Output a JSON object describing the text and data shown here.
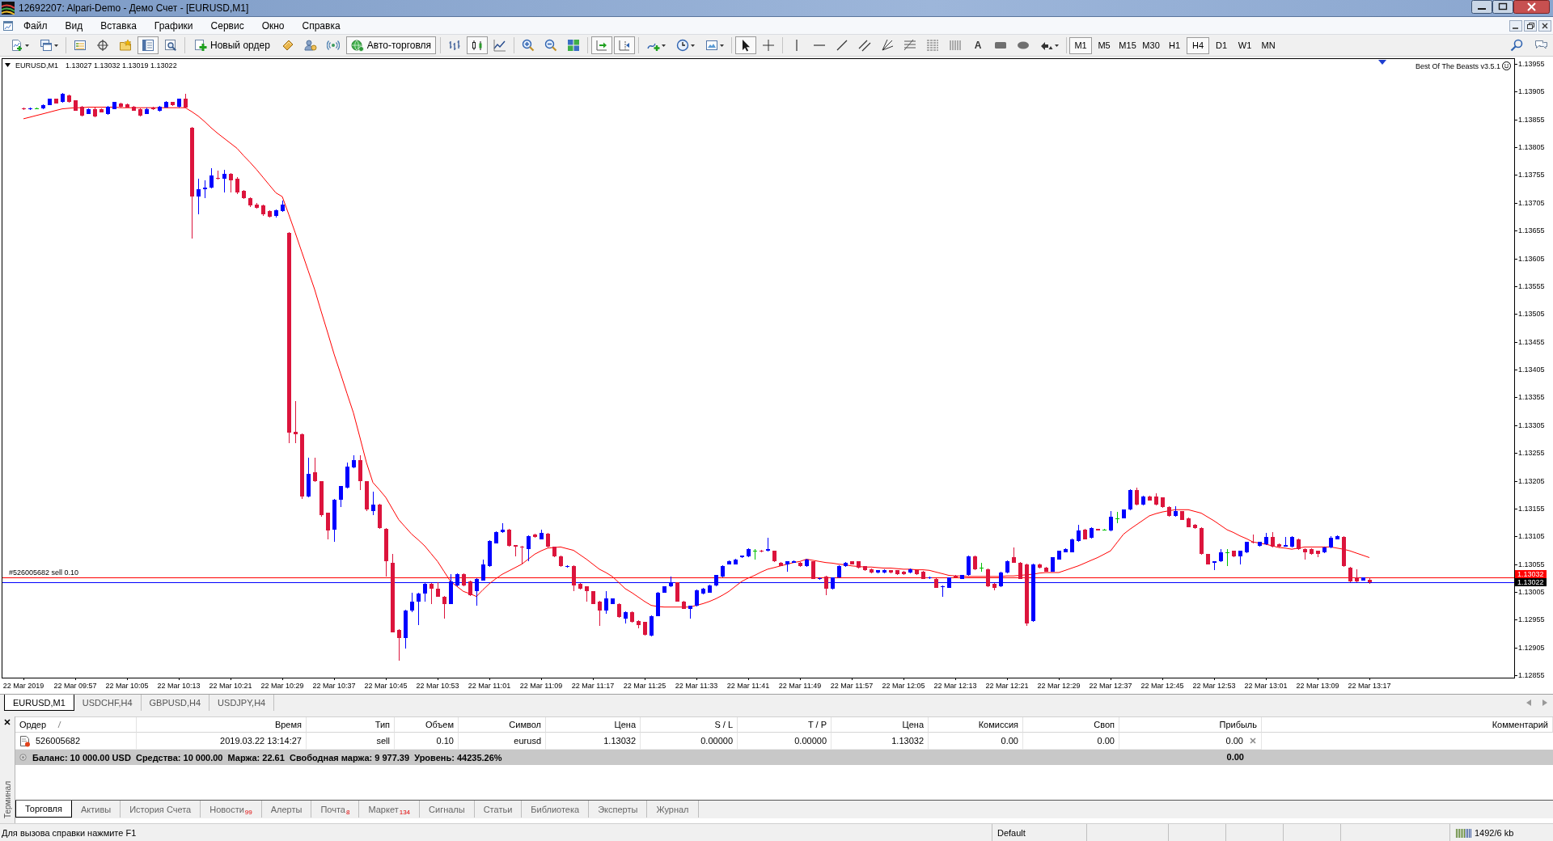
{
  "window": {
    "title": "12692207: Alpari-Demo - Демо Счет - [EURUSD,M1]"
  },
  "menu": [
    "Файл",
    "Вид",
    "Вставка",
    "Графики",
    "Сервис",
    "Окно",
    "Справка"
  ],
  "toolbar": {
    "windows": [
      {
        "selected": false
      },
      {
        "selected": false
      },
      {
        "selected": false
      },
      {
        "selected": true
      },
      {
        "selected": false
      }
    ],
    "new_order": "Новый ордер",
    "auto_trading": {
      "label": "Авто-торговля",
      "on": true
    },
    "chart_types": [
      {
        "selected": false
      },
      {
        "selected": true
      },
      {
        "selected": false
      }
    ],
    "chart_options": [
      {
        "selected": true
      },
      {
        "selected": true
      }
    ],
    "pointer_tools": [
      {
        "selected": true
      },
      {
        "selected": false
      }
    ],
    "text_tool": "A",
    "timeframes": [
      {
        "label": "M1",
        "selected": true
      },
      {
        "label": "M5",
        "selected": false
      },
      {
        "label": "M15",
        "selected": false
      },
      {
        "label": "M30",
        "selected": false
      },
      {
        "label": "H1",
        "selected": false
      },
      {
        "label": "H4",
        "selected": true
      },
      {
        "label": "D1",
        "selected": false
      },
      {
        "label": "W1",
        "selected": false
      },
      {
        "label": "MN",
        "selected": false
      }
    ]
  },
  "chart": {
    "symbol": "EURUSD,M1",
    "prices": "1.13027 1.13032 1.13019 1.13022",
    "indicator": "Best Of The Beasts v3.5.1",
    "price_tags": [
      {
        "label": "1.13032",
        "color": "#ff0000"
      },
      {
        "label": "1.13022",
        "color": "#000000"
      }
    ],
    "chart_data": {
      "type": "candlestick",
      "categories": [
        "22 Mar 2019",
        null,
        null,
        null,
        null,
        null,
        null,
        null,
        "22 Mar 09:57",
        null,
        null,
        null,
        null,
        null,
        null,
        null,
        "22 Mar 10:05",
        null,
        null,
        null,
        null,
        null,
        null,
        null,
        "22 Mar 10:13",
        null,
        null,
        null,
        null,
        null,
        null,
        null,
        "22 Mar 10:21",
        null,
        null,
        null,
        null,
        null,
        null,
        null,
        "22 Mar 10:29",
        null,
        null,
        null,
        null,
        null,
        null,
        null,
        "22 Mar 10:37",
        null,
        null,
        null,
        null,
        null,
        null,
        null,
        "22 Mar 10:45",
        null,
        null,
        null,
        null,
        null,
        null,
        null,
        "22 Mar 10:53",
        null,
        null,
        null,
        null,
        null,
        null,
        null,
        "22 Mar 11:01",
        null,
        null,
        null,
        null,
        null,
        null,
        null,
        "22 Mar 11:09",
        null,
        null,
        null,
        null,
        null,
        null,
        null,
        "22 Mar 11:17",
        null,
        null,
        null,
        null,
        null,
        null,
        null,
        "22 Mar 11:25",
        null,
        null,
        null,
        null,
        null,
        null,
        null,
        "22 Mar 11:33",
        null,
        null,
        null,
        null,
        null,
        null,
        null,
        "22 Mar 11:41",
        null,
        null,
        null,
        null,
        null,
        null,
        null,
        "22 Mar 11:49",
        null,
        null,
        null,
        null,
        null,
        null,
        null,
        "22 Mar 11:57",
        null,
        null,
        null,
        null,
        null,
        null,
        null,
        "22 Mar 12:05",
        null,
        null,
        null,
        null,
        null,
        null,
        null,
        "22 Mar 12:13",
        null,
        null,
        null,
        null,
        null,
        null,
        null,
        "22 Mar 12:21",
        null,
        null,
        null,
        null,
        null,
        null,
        null,
        "22 Mar 12:29",
        null,
        null,
        null,
        null,
        null,
        null,
        null,
        "22 Mar 12:37",
        null,
        null,
        null,
        null,
        null,
        null,
        null,
        "22 Mar 12:45",
        null,
        null,
        null,
        null,
        null,
        null,
        null,
        "22 Mar 12:53",
        null,
        null,
        null,
        null,
        null,
        null,
        null,
        "22 Mar 13:01",
        null,
        null,
        null,
        null,
        null,
        null,
        null,
        "22 Mar 13:09",
        null,
        null,
        null,
        null,
        null,
        null,
        null,
        "22 Mar 13:17"
      ],
      "ohlc": [
        [
          1.13875,
          1.13876,
          1.13872,
          1.13873
        ],
        [
          1.13873,
          1.13876,
          1.13872,
          1.13875
        ],
        [
          1.13875,
          1.13877,
          1.13873,
          1.13875
        ],
        [
          1.13875,
          1.13882,
          1.13874,
          1.13881
        ],
        [
          1.13881,
          1.13893,
          1.1388,
          1.13892
        ],
        [
          1.13892,
          1.13893,
          1.13883,
          1.13884
        ],
        [
          1.13886,
          1.13903,
          1.13885,
          1.13901
        ],
        [
          1.13898,
          1.13899,
          1.13885,
          1.13886
        ],
        [
          1.13889,
          1.1389,
          1.1387,
          1.13871
        ],
        [
          1.13878,
          1.13879,
          1.13861,
          1.13862
        ],
        [
          1.13865,
          1.13875,
          1.13864,
          1.13874
        ],
        [
          1.13874,
          1.13876,
          1.13859,
          1.13861
        ],
        [
          1.13874,
          1.13875,
          1.13867,
          1.13868
        ],
        [
          1.13865,
          1.13879,
          1.13863,
          1.13878
        ],
        [
          1.13874,
          1.13887,
          1.13873,
          1.13886
        ],
        [
          1.13883,
          1.13885,
          1.13877,
          1.13878
        ],
        [
          1.13882,
          1.13883,
          1.13876,
          1.13877
        ],
        [
          1.13878,
          1.13879,
          1.1387,
          1.13871
        ],
        [
          1.13874,
          1.13875,
          1.13861,
          1.13862
        ],
        [
          1.13865,
          1.13876,
          1.13864,
          1.13874
        ],
        [
          1.13877,
          1.13878,
          1.13872,
          1.13873
        ],
        [
          1.1387,
          1.13879,
          1.13869,
          1.13878
        ],
        [
          1.13877,
          1.13888,
          1.13876,
          1.13887
        ],
        [
          1.13886,
          1.13887,
          1.13879,
          1.1388
        ],
        [
          1.13878,
          1.13893,
          1.13877,
          1.13892
        ],
        [
          1.13892,
          1.13901,
          1.13875,
          1.13876
        ],
        [
          1.1384,
          1.13841,
          1.13641,
          1.13716
        ],
        [
          1.13716,
          1.13749,
          1.13684,
          1.13729
        ],
        [
          1.1373,
          1.13745,
          1.13714,
          1.13732
        ],
        [
          1.13732,
          1.13767,
          1.13731,
          1.13754
        ],
        [
          1.1375,
          1.13763,
          1.13747,
          1.13748
        ],
        [
          1.13748,
          1.13765,
          1.13723,
          1.13757
        ],
        [
          1.13757,
          1.13758,
          1.13723,
          1.13745
        ],
        [
          1.13749,
          1.13751,
          1.13721,
          1.13723
        ],
        [
          1.13727,
          1.13728,
          1.13712,
          1.13714
        ],
        [
          1.13714,
          1.13715,
          1.13698,
          1.137
        ],
        [
          1.13702,
          1.13704,
          1.13695,
          1.13696
        ],
        [
          1.137,
          1.13702,
          1.13682,
          1.13684
        ],
        [
          1.1369,
          1.13692,
          1.13678,
          1.1368
        ],
        [
          1.13681,
          1.13693,
          1.13679,
          1.13692
        ],
        [
          1.1369,
          1.13709,
          1.13689,
          1.13702
        ],
        [
          1.13651,
          1.13652,
          1.13273,
          1.13291
        ],
        [
          1.13293,
          1.13349,
          1.13273,
          1.13289
        ],
        [
          1.13289,
          1.1329,
          1.13173,
          1.13177
        ],
        [
          1.13177,
          1.13247,
          1.13175,
          1.13218
        ],
        [
          1.1322,
          1.13247,
          1.13203,
          1.13204
        ],
        [
          1.13204,
          1.13205,
          1.1314,
          1.13144
        ],
        [
          1.13147,
          1.13148,
          1.131,
          1.13116
        ],
        [
          1.13117,
          1.13172,
          1.13095,
          1.13171
        ],
        [
          1.13171,
          1.13196,
          1.13158,
          1.13195
        ],
        [
          1.13193,
          1.13238,
          1.13192,
          1.13231
        ],
        [
          1.13229,
          1.13251,
          1.13228,
          1.13242
        ],
        [
          1.13242,
          1.13251,
          1.13189,
          1.13204
        ],
        [
          1.13204,
          1.13205,
          1.13151,
          1.13153
        ],
        [
          1.1315,
          1.13186,
          1.13144,
          1.13162
        ],
        [
          1.13162,
          1.13163,
          1.13118,
          1.1312
        ],
        [
          1.13119,
          1.1312,
          1.13033,
          1.1306
        ],
        [
          1.13058,
          1.13073,
          1.12932,
          1.12933
        ],
        [
          1.12937,
          1.12938,
          1.12882,
          1.12922
        ],
        [
          1.12922,
          1.12973,
          1.12904,
          1.12972
        ],
        [
          1.12972,
          1.13004,
          1.12969,
          1.12987
        ],
        [
          1.12987,
          1.13003,
          1.12946,
          1.13002
        ],
        [
          1.13002,
          1.13022,
          1.12988,
          1.1302
        ],
        [
          1.1302,
          1.13021,
          1.12984,
          1.13011
        ],
        [
          1.13011,
          1.13022,
          1.12996,
          1.12997
        ],
        [
          1.12997,
          1.12998,
          1.12957,
          1.12984
        ],
        [
          1.12984,
          1.13037,
          1.12983,
          1.13024
        ],
        [
          1.13017,
          1.13038,
          1.13016,
          1.13037
        ],
        [
          1.13037,
          1.13038,
          1.13016,
          1.13017
        ],
        [
          1.13024,
          1.13025,
          1.12998,
          1.12999
        ],
        [
          1.13006,
          1.1303,
          1.1298,
          1.13029
        ],
        [
          1.13026,
          1.13064,
          1.13025,
          1.13055
        ],
        [
          1.13051,
          1.13098,
          1.1305,
          1.13097
        ],
        [
          1.13093,
          1.13114,
          1.13092,
          1.13113
        ],
        [
          1.13113,
          1.13129,
          1.13112,
          1.13117
        ],
        [
          1.13117,
          1.13118,
          1.13087,
          1.13088
        ],
        [
          1.13089,
          1.1309,
          1.13069,
          1.13087
        ],
        [
          1.13087,
          1.13088,
          1.13055,
          1.13085
        ],
        [
          1.13082,
          1.13107,
          1.1306,
          1.13106
        ],
        [
          1.13109,
          1.1311,
          1.13103,
          1.13104
        ],
        [
          1.131,
          1.13117,
          1.13099,
          1.13111
        ],
        [
          1.1311,
          1.13111,
          1.13085,
          1.13086
        ],
        [
          1.13086,
          1.13087,
          1.13068,
          1.13069
        ],
        [
          1.13069,
          1.1307,
          1.1305,
          1.13051
        ],
        [
          1.1305,
          1.13053,
          1.13049,
          1.13052
        ],
        [
          1.13052,
          1.13053,
          1.13006,
          1.13017
        ],
        [
          1.1302,
          1.13021,
          1.1301,
          1.13011
        ],
        [
          1.13015,
          1.13016,
          1.12988,
          1.13006
        ],
        [
          1.13006,
          1.13007,
          1.12983,
          1.12984
        ],
        [
          1.12988,
          1.12989,
          1.12944,
          1.12971
        ],
        [
          1.12971,
          1.13006,
          1.12966,
          1.12993
        ],
        [
          1.12984,
          1.12994,
          1.12983,
          1.12993
        ],
        [
          1.12984,
          1.12985,
          1.12959,
          1.1296
        ],
        [
          1.12957,
          1.1297,
          1.12948,
          1.12969
        ],
        [
          1.12969,
          1.1297,
          1.1295,
          1.12951
        ],
        [
          1.12953,
          1.12954,
          1.12939,
          1.12946
        ],
        [
          1.12951,
          1.12952,
          1.12927,
          1.12928
        ],
        [
          1.12926,
          1.12963,
          1.12925,
          1.12962
        ],
        [
          1.12962,
          1.13005,
          1.12961,
          1.13004
        ],
        [
          1.13004,
          1.13016,
          1.13003,
          1.13015
        ],
        [
          1.13015,
          1.13033,
          1.13014,
          1.13022
        ],
        [
          1.13022,
          1.13023,
          1.12987,
          1.12988
        ],
        [
          1.12988,
          1.12989,
          1.12974,
          1.12975
        ],
        [
          1.12975,
          1.12981,
          1.12957,
          1.1298
        ],
        [
          1.1298,
          1.13009,
          1.12979,
          1.13008
        ],
        [
          1.13002,
          1.13012,
          1.13001,
          1.13011
        ],
        [
          1.13004,
          1.13018,
          1.13003,
          1.13017
        ],
        [
          1.13017,
          1.13036,
          1.13016,
          1.13035
        ],
        [
          1.13033,
          1.13053,
          1.13032,
          1.13052
        ],
        [
          1.13055,
          1.13062,
          1.13054,
          1.13061
        ],
        [
          1.13055,
          1.13065,
          1.13054,
          1.13064
        ],
        [
          1.13067,
          1.13071,
          1.13066,
          1.1307
        ],
        [
          1.13069,
          1.13083,
          1.13068,
          1.13082
        ],
        [
          1.13079,
          1.13082,
          1.13064,
          1.13079
        ],
        [
          1.1308,
          1.13081,
          1.13077,
          1.13078
        ],
        [
          1.13079,
          1.13102,
          1.13078,
          1.13082
        ],
        [
          1.13079,
          1.1308,
          1.13059,
          1.1306
        ],
        [
          1.13058,
          1.13059,
          1.13051,
          1.13052
        ],
        [
          1.13055,
          1.13061,
          1.13042,
          1.1306
        ],
        [
          1.13058,
          1.13062,
          1.13057,
          1.13061
        ],
        [
          1.13058,
          1.13059,
          1.1305,
          1.13051
        ],
        [
          1.13051,
          1.13065,
          1.1305,
          1.13064
        ],
        [
          1.1306,
          1.13061,
          1.13028,
          1.13029
        ],
        [
          1.13028,
          1.13031,
          1.13027,
          1.1303
        ],
        [
          1.13033,
          1.13034,
          1.12999,
          1.13011
        ],
        [
          1.13011,
          1.13032,
          1.1301,
          1.13031
        ],
        [
          1.13031,
          1.13053,
          1.1303,
          1.13052
        ],
        [
          1.13051,
          1.13059,
          1.1305,
          1.13058
        ],
        [
          1.1306,
          1.13061,
          1.13054,
          1.13055
        ],
        [
          1.1306,
          1.13061,
          1.13048,
          1.13049
        ],
        [
          1.13051,
          1.13052,
          1.13043,
          1.13044
        ],
        [
          1.13046,
          1.13047,
          1.13039,
          1.1304
        ],
        [
          1.1304,
          1.13045,
          1.13039,
          1.13044
        ],
        [
          1.1304,
          1.13046,
          1.13039,
          1.13045
        ],
        [
          1.13044,
          1.13045,
          1.13039,
          1.1304
        ],
        [
          1.13044,
          1.13045,
          1.13036,
          1.13037
        ],
        [
          1.13042,
          1.13043,
          1.13036,
          1.13037
        ],
        [
          1.1304,
          1.13047,
          1.13039,
          1.13046
        ],
        [
          1.13044,
          1.13045,
          1.13036,
          1.13037
        ],
        [
          1.13042,
          1.13043,
          1.13028,
          1.13029
        ],
        [
          1.1303,
          1.13033,
          1.13029,
          1.13032
        ],
        [
          1.13029,
          1.1303,
          1.13012,
          1.13013
        ],
        [
          1.13014,
          1.13017,
          1.12997,
          1.13016
        ],
        [
          1.13013,
          1.13032,
          1.13012,
          1.13031
        ],
        [
          1.13034,
          1.13035,
          1.13031,
          1.13032
        ],
        [
          1.13029,
          1.13036,
          1.13028,
          1.13035
        ],
        [
          1.13035,
          1.1307,
          1.13034,
          1.13069
        ],
        [
          1.13069,
          1.1307,
          1.13045,
          1.13046
        ],
        [
          1.13049,
          1.13058,
          1.13042,
          1.13049
        ],
        [
          1.13046,
          1.13047,
          1.13014,
          1.13015
        ],
        [
          1.1302,
          1.13021,
          1.13008,
          1.13013
        ],
        [
          1.13015,
          1.13041,
          1.13014,
          1.1304
        ],
        [
          1.1304,
          1.13062,
          1.13039,
          1.13061
        ],
        [
          1.13067,
          1.13085,
          1.13057,
          1.13058
        ],
        [
          1.13058,
          1.13059,
          1.13028,
          1.13029
        ],
        [
          1.13055,
          1.13056,
          1.12944,
          1.12948
        ],
        [
          1.12953,
          1.13056,
          1.12952,
          1.13055
        ],
        [
          1.13055,
          1.13056,
          1.13048,
          1.13049
        ],
        [
          1.13049,
          1.1305,
          1.13041,
          1.13042
        ],
        [
          1.13042,
          1.13068,
          1.13041,
          1.13067
        ],
        [
          1.13064,
          1.1308,
          1.13063,
          1.13079
        ],
        [
          1.13077,
          1.13083,
          1.13076,
          1.13082
        ],
        [
          1.13077,
          1.13101,
          1.13076,
          1.131
        ],
        [
          1.13097,
          1.13126,
          1.13096,
          1.13115
        ],
        [
          1.13117,
          1.13118,
          1.13099,
          1.131
        ],
        [
          1.13102,
          1.13121,
          1.13101,
          1.1312
        ],
        [
          1.13118,
          1.13119,
          1.13115,
          1.13116
        ],
        [
          1.13117,
          1.13119,
          1.13115,
          1.13117
        ],
        [
          1.13115,
          1.1315,
          1.13114,
          1.1314
        ],
        [
          1.13138,
          1.13149,
          1.13129,
          1.13138
        ],
        [
          1.13138,
          1.13154,
          1.13137,
          1.13153
        ],
        [
          1.13153,
          1.1319,
          1.13152,
          1.13189
        ],
        [
          1.13189,
          1.13193,
          1.13161,
          1.13162
        ],
        [
          1.13162,
          1.13178,
          1.13161,
          1.13177
        ],
        [
          1.13177,
          1.13178,
          1.13169,
          1.1317
        ],
        [
          1.13177,
          1.13182,
          1.13161,
          1.13162
        ],
        [
          1.13175,
          1.13176,
          1.13157,
          1.13158
        ],
        [
          1.13158,
          1.13159,
          1.13141,
          1.13142
        ],
        [
          1.13142,
          1.13159,
          1.13141,
          1.1315
        ],
        [
          1.1315,
          1.13151,
          1.13134,
          1.13135
        ],
        [
          1.13138,
          1.13139,
          1.13121,
          1.13122
        ],
        [
          1.13126,
          1.13127,
          1.13119,
          1.1312
        ],
        [
          1.1312,
          1.13121,
          1.13072,
          1.13073
        ],
        [
          1.13073,
          1.13074,
          1.13054,
          1.13055
        ],
        [
          1.13058,
          1.13061,
          1.13044,
          1.1306
        ],
        [
          1.1306,
          1.13082,
          1.13059,
          1.13076
        ],
        [
          1.13077,
          1.13082,
          1.13052,
          1.13077
        ],
        [
          1.13079,
          1.1308,
          1.13068,
          1.13069
        ],
        [
          1.13069,
          1.1308,
          1.13055,
          1.13079
        ],
        [
          1.13076,
          1.13096,
          1.13075,
          1.13095
        ],
        [
          1.13096,
          1.13109,
          1.13093,
          1.13094
        ],
        [
          1.13088,
          1.13096,
          1.13087,
          1.13095
        ],
        [
          1.13091,
          1.13111,
          1.1309,
          1.13104
        ],
        [
          1.13104,
          1.13113,
          1.13085,
          1.13086
        ],
        [
          1.13091,
          1.13092,
          1.13085,
          1.13086
        ],
        [
          1.13087,
          1.13104,
          1.13086,
          1.13089
        ],
        [
          1.13086,
          1.13105,
          1.13085,
          1.13104
        ],
        [
          1.131,
          1.13101,
          1.13081,
          1.13082
        ],
        [
          1.13082,
          1.13083,
          1.13064,
          1.13077
        ],
        [
          1.13082,
          1.13083,
          1.13072,
          1.13073
        ],
        [
          1.13079,
          1.1308,
          1.13067,
          1.13073
        ],
        [
          1.13076,
          1.13086,
          1.13075,
          1.13085
        ],
        [
          1.13085,
          1.13106,
          1.13084,
          1.13102
        ],
        [
          1.131,
          1.13107,
          1.13099,
          1.13106
        ],
        [
          1.13104,
          1.13105,
          1.1305,
          1.13051
        ],
        [
          1.13049,
          1.1305,
          1.13023,
          1.13024
        ],
        [
          1.13031,
          1.13046,
          1.13023,
          1.13024
        ],
        [
          1.13026,
          1.13032,
          1.13025,
          1.13031
        ],
        [
          1.13027,
          1.13032,
          1.13019,
          1.13022
        ]
      ],
      "series": [
        {
          "type": "line",
          "color": "#ff0000",
          "values": [
            1.13856,
            1.13859,
            1.13862,
            1.13865,
            1.13868,
            1.13871,
            1.13874,
            1.13875,
            1.13876,
            1.13876,
            1.13877,
            1.13877,
            1.13877,
            1.13877,
            1.13877,
            1.13876,
            1.13876,
            1.13876,
            1.13876,
            1.13876,
            1.13876,
            1.13876,
            1.13876,
            1.13876,
            1.13876,
            1.13876,
            1.13869,
            1.13861,
            1.13851,
            1.1384,
            1.1383,
            1.13821,
            1.13812,
            1.13803,
            1.1379,
            1.13778,
            1.13765,
            1.13751,
            1.13737,
            1.13723,
            1.13716,
            1.13684,
            1.13651,
            1.13617,
            1.13583,
            1.13549,
            1.1351,
            1.13472,
            1.13433,
            1.13398,
            1.13362,
            1.13327,
            1.13283,
            1.13238,
            1.13202,
            1.13189,
            1.13175,
            1.13155,
            1.13135,
            1.13122,
            1.13109,
            1.13099,
            1.13088,
            1.13074,
            1.1306,
            1.13042,
            1.13024,
            1.13015,
            1.13006,
            1.13002,
            1.12997,
            1.13009,
            1.1302,
            1.13029,
            1.13037,
            1.13043,
            1.13049,
            1.13055,
            1.13064,
            1.13073,
            1.13079,
            1.13084,
            1.13085,
            1.13086,
            1.13083,
            1.1308,
            1.13072,
            1.13064,
            1.13055,
            1.13046,
            1.1304,
            1.13033,
            1.13022,
            1.13011,
            1.13004,
            1.12996,
            1.12988,
            1.12981,
            1.12979,
            1.12978,
            1.12978,
            1.12978,
            1.12978,
            1.12978,
            1.12981,
            1.12984,
            1.12988,
            1.12993,
            1.12999,
            1.13006,
            1.13015,
            1.13024,
            1.1303,
            1.13035,
            1.13041,
            1.13046,
            1.13049,
            1.13052,
            1.13055,
            1.13058,
            1.1306,
            1.13064,
            1.13062,
            1.1306,
            1.13058,
            1.13057,
            1.13055,
            1.13054,
            1.13052,
            1.13051,
            1.1305,
            1.1305,
            1.13049,
            1.13048,
            1.13048,
            1.13047,
            1.13046,
            1.13046,
            1.13045,
            1.13045,
            1.13044,
            1.13041,
            1.13038,
            1.13035,
            1.13034,
            1.13034,
            1.13033,
            1.13033,
            1.13033,
            1.13033,
            1.13033,
            1.13033,
            1.13034,
            1.13034,
            1.13035,
            1.13036,
            1.13037,
            1.13039,
            1.1304,
            1.1304,
            1.1304,
            1.13044,
            1.13048,
            1.13052,
            1.13057,
            1.13062,
            1.13067,
            1.13073,
            1.13079,
            1.13094,
            1.13109,
            1.13118,
            1.13126,
            1.13134,
            1.13142,
            1.13146,
            1.13149,
            1.13151,
            1.13153,
            1.13153,
            1.13153,
            1.1315,
            1.13147,
            1.1314,
            1.13133,
            1.13125,
            1.13117,
            1.13112,
            1.13106,
            1.13101,
            1.13095,
            1.13093,
            1.13091,
            1.13088,
            1.13085,
            1.13084,
            1.13082,
            1.13084,
            1.13086,
            1.13086,
            1.13086,
            1.13086,
            1.13086,
            1.13084,
            1.13082,
            1.13079,
            1.13075,
            1.13071,
            1.13067
          ]
        }
      ],
      "ylim": [
        1.12851,
        1.13965
      ],
      "yticks": [
        1.12855,
        1.12905,
        1.12955,
        1.13005,
        1.13055,
        1.13105,
        1.13155,
        1.13205,
        1.13255,
        1.13305,
        1.13355,
        1.13405,
        1.13455,
        1.13505,
        1.13555,
        1.13605,
        1.13655,
        1.13705,
        1.13755,
        1.13805,
        1.13855,
        1.13905,
        1.13955
      ],
      "ref_lines": [
        {
          "axis": "y",
          "value": 1.13032,
          "label": "#526005682 sell 0.10",
          "color": "#ff0000"
        },
        {
          "axis": "y",
          "value": 1.13022,
          "color": "#0000ff"
        }
      ]
    }
  },
  "chart_tabs": [
    {
      "label": "EURUSD,M1",
      "selected": true
    },
    {
      "label": "USDCHF,H4",
      "selected": false
    },
    {
      "label": "GBPUSD,H4",
      "selected": false
    },
    {
      "label": "USDJPY,H4",
      "selected": false
    }
  ],
  "terminal": {
    "side_label": "Терминал",
    "columns": [
      {
        "label": "Ордер",
        "sorted": true
      },
      {
        "label": "Время",
        "sorted": false
      },
      {
        "label": "Тип",
        "sorted": false
      },
      {
        "label": "Объем",
        "sorted": false
      },
      {
        "label": "Символ",
        "sorted": false
      },
      {
        "label": "Цена",
        "sorted": false
      },
      {
        "label": "S / L",
        "sorted": false
      },
      {
        "label": "T / P",
        "sorted": false
      },
      {
        "label": "Цена",
        "sorted": false
      },
      {
        "label": "Комиссия",
        "sorted": false
      },
      {
        "label": "Своп",
        "sorted": false
      },
      {
        "label": "Прибыль",
        "sorted": false
      },
      {
        "label": "Комментарий",
        "sorted": false
      }
    ],
    "orders": [
      {
        "cells": [
          "526005682",
          "2019.03.22 13:14:27",
          "sell",
          "0.10",
          "eurusd",
          "1.13032",
          "0.00000",
          "0.00000",
          "1.13032",
          "0.00",
          "0.00",
          "0.00"
        ]
      }
    ],
    "summary": {
      "text": "Баланс: 10 000.00 USD  Средства: 10 000.00  Маржа: 22.61  Свободная маржа: 9 977.39  Уровень: 44235.26%",
      "profit": "0.00"
    },
    "tabs": [
      {
        "label": "Торговля",
        "selected": true
      },
      {
        "label": "Активы",
        "selected": false
      },
      {
        "label": "История Счета",
        "selected": false
      },
      {
        "label": "Новости",
        "badge": "99",
        "selected": false
      },
      {
        "label": "Алерты",
        "selected": false
      },
      {
        "label": "Почта",
        "badge": "8",
        "selected": false
      },
      {
        "label": "Маркет",
        "badge": "134",
        "selected": false
      },
      {
        "label": "Сигналы",
        "selected": false
      },
      {
        "label": "Статьи",
        "selected": false
      },
      {
        "label": "Библиотека",
        "selected": false
      },
      {
        "label": "Эксперты",
        "selected": false
      },
      {
        "label": "Журнал",
        "selected": false
      }
    ]
  },
  "status_bar": {
    "help": "Для вызова справки нажмите F1",
    "profile": "Default",
    "traffic": "1492/6 kb"
  }
}
